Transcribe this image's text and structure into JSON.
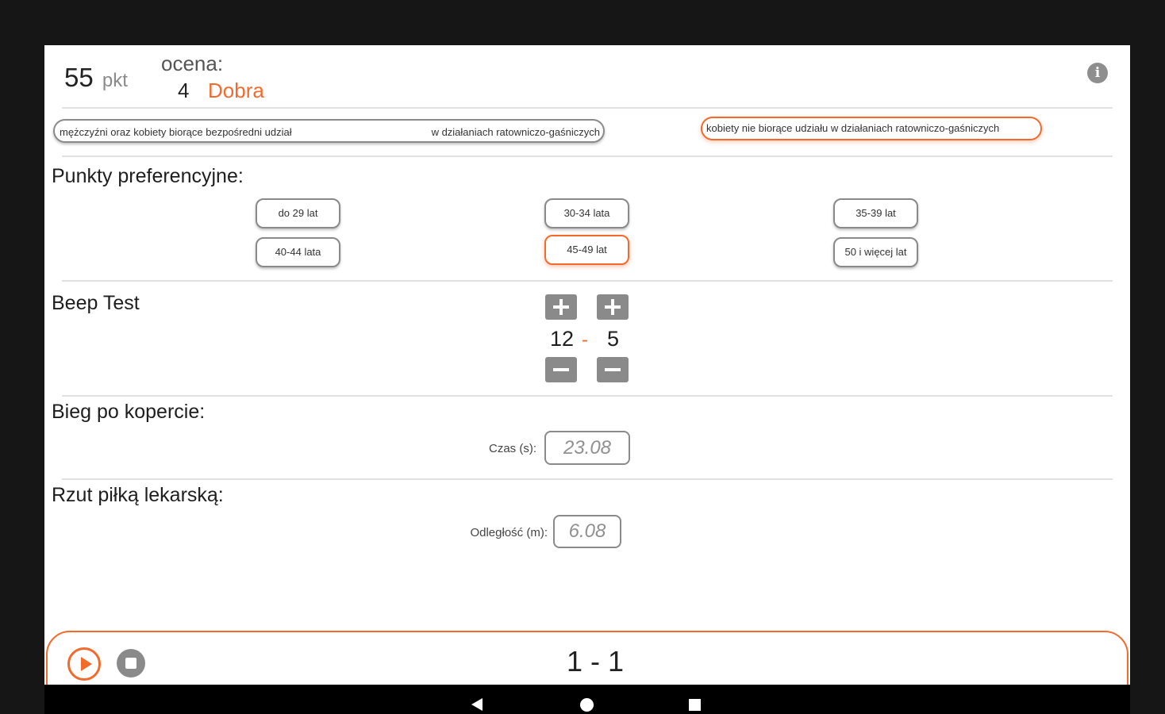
{
  "header": {
    "score_value": "55",
    "score_unit": "pkt",
    "grade_label": "ocena:",
    "grade_number": "4",
    "grade_text": "Dobra"
  },
  "category": {
    "options": [
      {
        "part1": "mężczyźni oraz kobiety biorące bezpośredni udział",
        "part2": "w działaniach ratowniczo-gaśniczych",
        "selected": false
      },
      {
        "part1": "kobiety nie biorące udziału w działaniach ratowniczo-gaśniczych",
        "selected": true
      }
    ]
  },
  "preferences": {
    "title": "Punkty preferencyjne:",
    "options": [
      {
        "label": "do 29 lat",
        "selected": false
      },
      {
        "label": "30-34 lata",
        "selected": false
      },
      {
        "label": "35-39 lat",
        "selected": false
      },
      {
        "label": "40-44 lata",
        "selected": false
      },
      {
        "label": "45-49 lat",
        "selected": true
      },
      {
        "label": "50 i więcej lat",
        "selected": false
      }
    ]
  },
  "beep_test": {
    "title": "Beep Test",
    "level": "12",
    "separator": "-",
    "shuttle": "5"
  },
  "envelope_run": {
    "title": "Bieg po kopercie:",
    "label": "Czas (s):",
    "value": "23.08"
  },
  "ball_throw": {
    "title": "Rzut piłką lekarską:",
    "label": "Odległość (m):",
    "value": "6.08"
  },
  "bottom_bar": {
    "score": "1 - 1"
  },
  "colors": {
    "accent": "#f36a2d",
    "gray": "#8a8a8a"
  }
}
